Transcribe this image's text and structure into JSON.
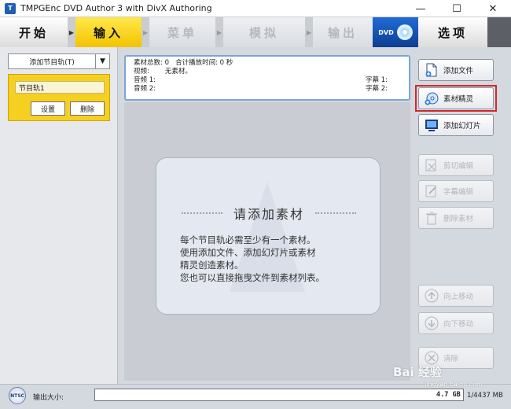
{
  "window": {
    "title": "TMPGEnc DVD Author 3 with DivX Authoring",
    "minimize": "—",
    "maximize": "☐",
    "close": "✕"
  },
  "nav": {
    "start": "开始",
    "input": "输入",
    "menu": "菜单",
    "simulate": "模拟",
    "output": "输出",
    "dvd_badge": "DVD",
    "options": "选项"
  },
  "left_panel": {
    "add_track": "添加节目轨(T)",
    "track_name": "节目轨1",
    "settings": "设置",
    "delete": "删除"
  },
  "info": {
    "total_label": "素材总数: 0",
    "duration_label": "合计播放时间: 0 秒",
    "video_label": "视频:",
    "video_value": "无素材。",
    "audio1_label": "音频 1:",
    "audio2_label": "音频 2:",
    "sub1_label": "字幕 1:",
    "sub2_label": "字幕 2:"
  },
  "hint": {
    "title": "请添加素材",
    "lines": [
      "每个节目轨必需至少有一个素材。",
      "使用添加文件、添加幻灯片或素材",
      "精灵创造素材。",
      "您也可以直接拖曳文件到素材列表。"
    ]
  },
  "right_buttons": {
    "add_file": "添加文件",
    "source_wizard": "素材精灵",
    "add_slideshow": "添加幻灯片",
    "cut_edit": "剪切编辑",
    "subtitle_edit": "字幕编辑",
    "delete_source": "删除素材",
    "move_up": "向上移动",
    "move_down": "向下移动",
    "clear": "清除"
  },
  "status": {
    "ntsc": "NTSC",
    "output_size_label": "输出大小:",
    "capacity_text": "4.7 GB",
    "capacity_fraction": 0.0,
    "size_readout": "1/4437 MB"
  },
  "watermark": {
    "text": "Bai 经验",
    "sub": "jingyan.baidu.com"
  }
}
